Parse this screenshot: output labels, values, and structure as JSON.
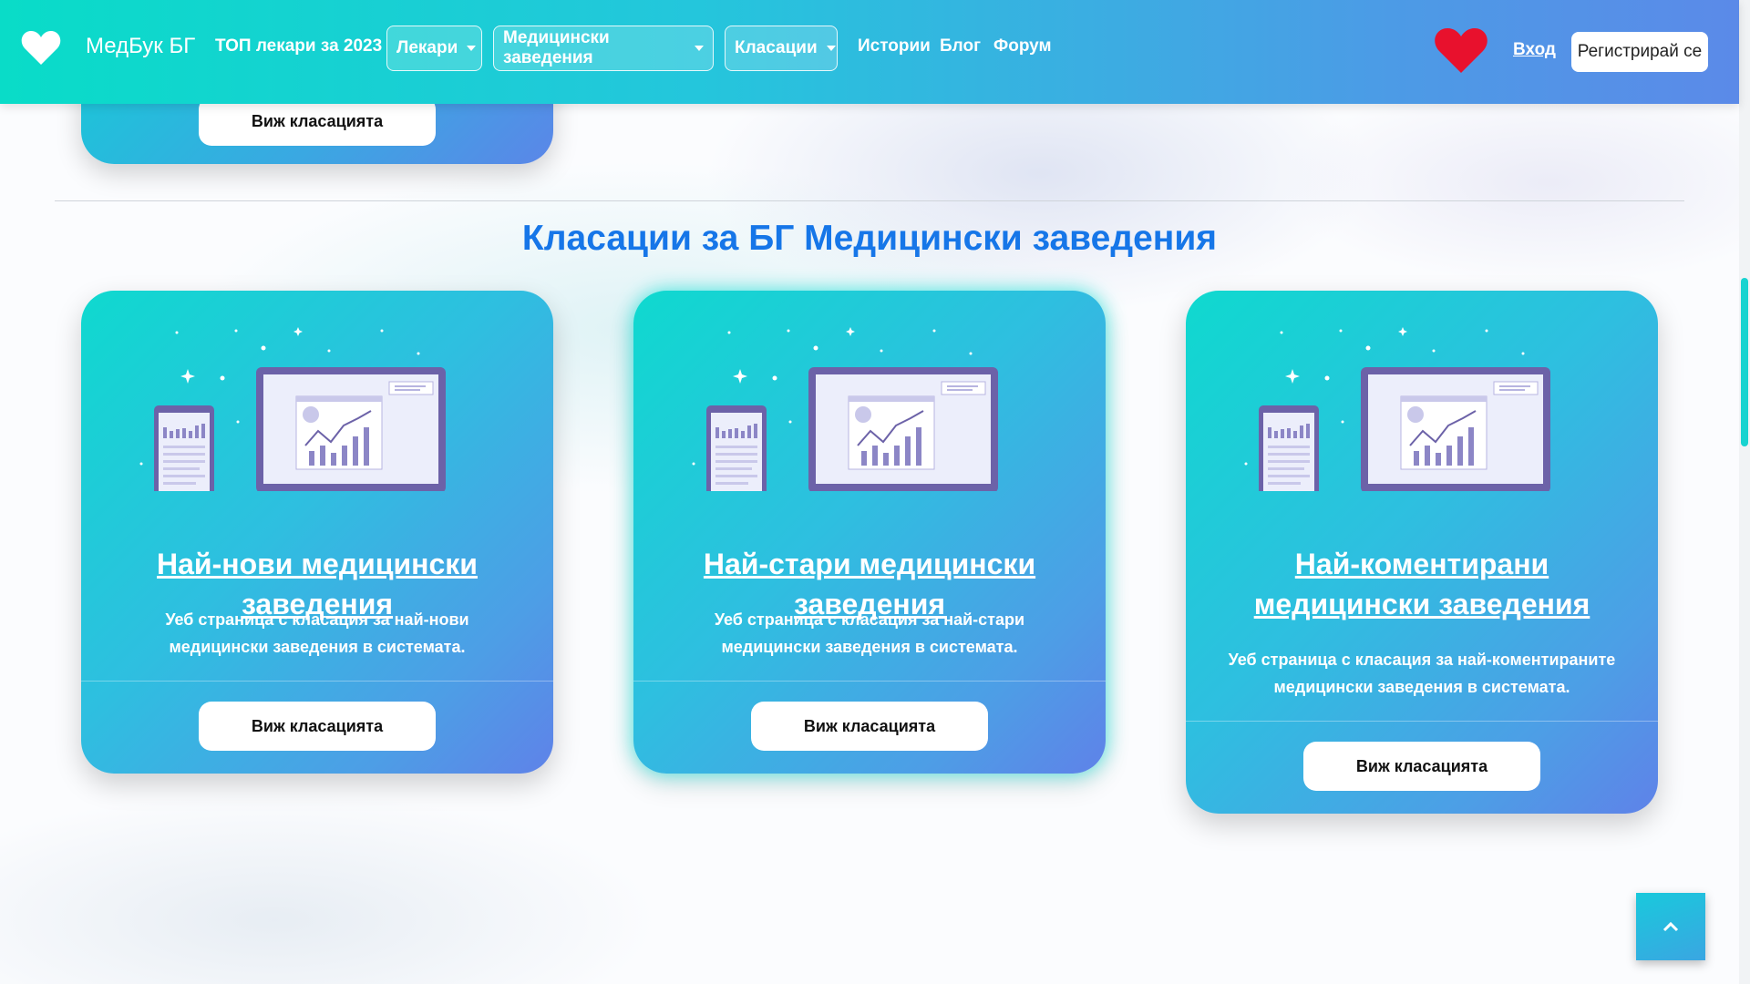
{
  "nav": {
    "brand": "МедБук БГ",
    "top_doctors": "ТОП лекари за 2023",
    "doctors": "Лекари",
    "facilities": "Медицински заведения",
    "rankings": "Класации",
    "stories": "Истории",
    "blog": "Блог",
    "forum": "Форум",
    "login": "Вход",
    "register": "Регистрирай се"
  },
  "section_title": "Класации за БГ Медицински заведения",
  "view_ranking": "Виж класацията",
  "cards": [
    {
      "title": "Най-нови медицински заведения",
      "description": "Уеб страница с класация за най-нови медицински заведения в системата.",
      "button": "Виж класацията"
    },
    {
      "title": "Най-стари медицински заведения",
      "description": "Уеб страница с класация за най-стари медицински заведения в системата.",
      "button": "Виж класацията"
    },
    {
      "title": "Най-коментирани медицински заведения",
      "description": "Уеб страница с класация за най-коментираните медицински заведения в системата.",
      "button": "Виж класацията"
    }
  ],
  "colors": {
    "title_blue": "#1676e8",
    "nav_start": "#09dcc8",
    "nav_end": "#5b8ae8",
    "heart_red": "#e8112d"
  },
  "icons": {
    "brand": "heart-icon",
    "favorites": "heart-icon",
    "scroll_top": "chevron-up-icon"
  }
}
